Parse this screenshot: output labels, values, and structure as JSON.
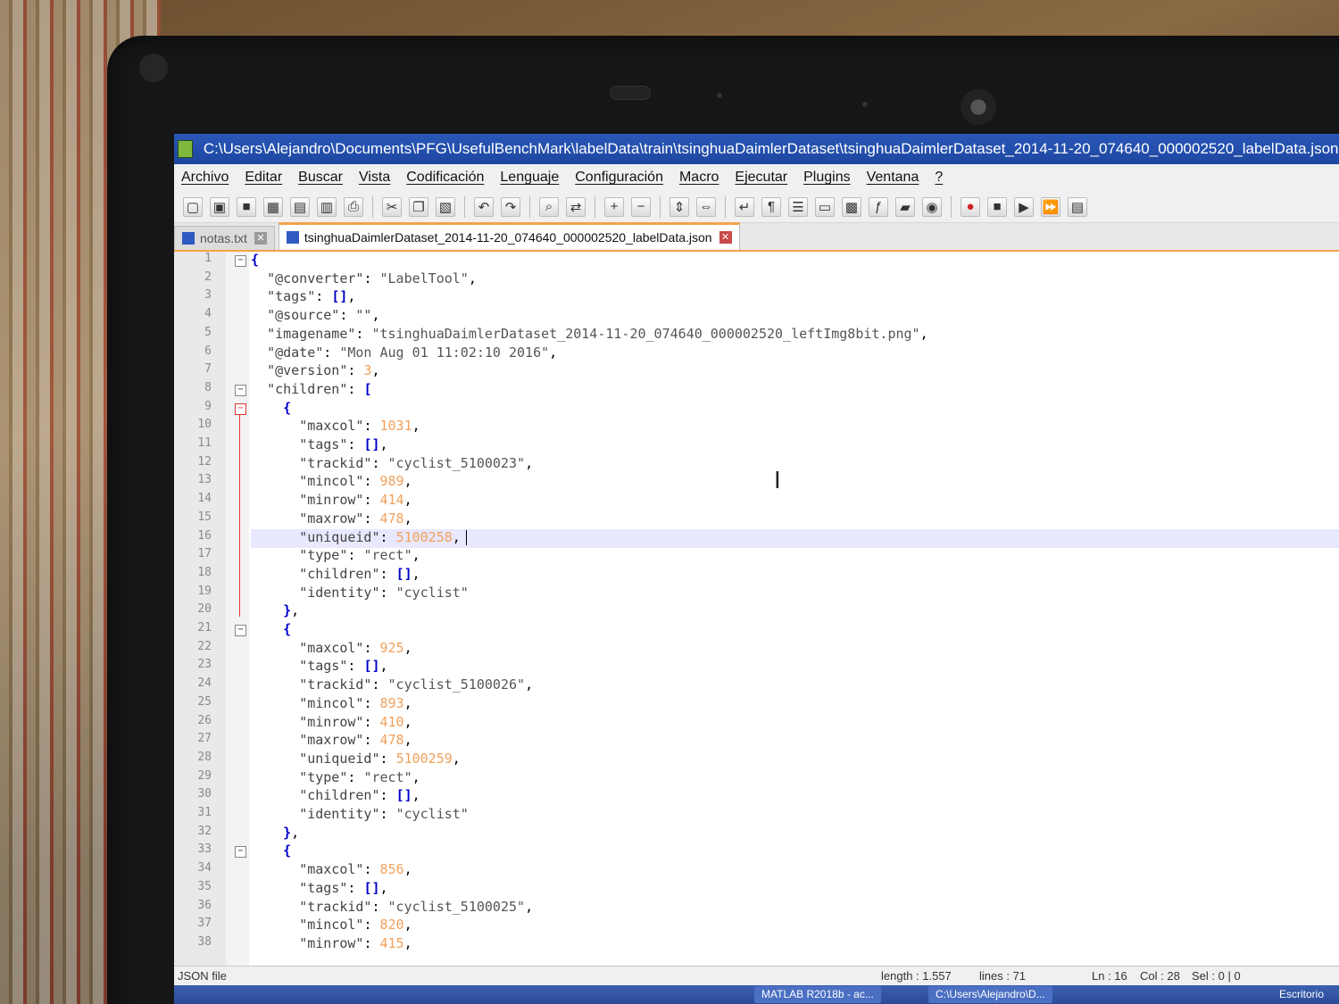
{
  "window": {
    "title": "C:\\Users\\Alejandro\\Documents\\PFG\\UsefulBenchMark\\labelData\\train\\tsinghuaDaimlerDataset\\tsinghuaDaimlerDataset_2014-11-20_074640_000002520_labelData.json - Notepad++"
  },
  "menu": [
    "Archivo",
    "Editar",
    "Buscar",
    "Vista",
    "Codificación",
    "Lenguaje",
    "Configuración",
    "Macro",
    "Ejecutar",
    "Plugins",
    "Ventana",
    "?"
  ],
  "tabs": [
    {
      "label": "notas.txt",
      "active": false
    },
    {
      "label": "tsinghuaDaimlerDataset_2014-11-20_074640_000002520_labelData.json",
      "active": true
    }
  ],
  "editor": {
    "current_line": 16,
    "lines": [
      {
        "n": "1",
        "text": "{",
        "fold": "open"
      },
      {
        "n": "2",
        "text": "  \"@converter\": \"LabelTool\","
      },
      {
        "n": "3",
        "text": "  \"tags\": [],"
      },
      {
        "n": "4",
        "text": "  \"@source\": \"\","
      },
      {
        "n": "5",
        "text": "  \"imagename\": \"tsinghuaDaimlerDataset_2014-11-20_074640_000002520_leftImg8bit.png\","
      },
      {
        "n": "6",
        "text": "  \"@date\": \"Mon Aug 01 11:02:10 2016\","
      },
      {
        "n": "7",
        "text": "  \"@version\": 3,"
      },
      {
        "n": "8",
        "text": "  \"children\": [",
        "fold": "open"
      },
      {
        "n": "9",
        "text": "    {",
        "fold": "open-red"
      },
      {
        "n": "10",
        "text": "      \"maxcol\": 1031,"
      },
      {
        "n": "11",
        "text": "      \"tags\": [],"
      },
      {
        "n": "12",
        "text": "      \"trackid\": \"cyclist_5100023\","
      },
      {
        "n": "13",
        "text": "      \"mincol\": 989,"
      },
      {
        "n": "14",
        "text": "      \"minrow\": 414,"
      },
      {
        "n": "15",
        "text": "      \"maxrow\": 478,"
      },
      {
        "n": "16",
        "text": "      \"uniqueid\": 5100258,"
      },
      {
        "n": "17",
        "text": "      \"type\": \"rect\","
      },
      {
        "n": "18",
        "text": "      \"children\": [],"
      },
      {
        "n": "19",
        "text": "      \"identity\": \"cyclist\""
      },
      {
        "n": "20",
        "text": "    },"
      },
      {
        "n": "21",
        "text": "    {",
        "fold": "open"
      },
      {
        "n": "22",
        "text": "      \"maxcol\": 925,"
      },
      {
        "n": "23",
        "text": "      \"tags\": [],"
      },
      {
        "n": "24",
        "text": "      \"trackid\": \"cyclist_5100026\","
      },
      {
        "n": "25",
        "text": "      \"mincol\": 893,"
      },
      {
        "n": "26",
        "text": "      \"minrow\": 410,"
      },
      {
        "n": "27",
        "text": "      \"maxrow\": 478,"
      },
      {
        "n": "28",
        "text": "      \"uniqueid\": 5100259,"
      },
      {
        "n": "29",
        "text": "      \"type\": \"rect\","
      },
      {
        "n": "30",
        "text": "      \"children\": [],"
      },
      {
        "n": "31",
        "text": "      \"identity\": \"cyclist\""
      },
      {
        "n": "32",
        "text": "    },"
      },
      {
        "n": "33",
        "text": "    {",
        "fold": "open"
      },
      {
        "n": "34",
        "text": "      \"maxcol\": 856,"
      },
      {
        "n": "35",
        "text": "      \"tags\": [],"
      },
      {
        "n": "36",
        "text": "      \"trackid\": \"cyclist_5100025\","
      },
      {
        "n": "37",
        "text": "      \"mincol\": 820,"
      },
      {
        "n": "38",
        "text": "      \"minrow\": 415,"
      }
    ]
  },
  "status": {
    "language": "JSON file",
    "length": "length : 1.557",
    "lines": "lines : 71",
    "ln": "Ln : 16",
    "col": "Col : 28",
    "sel": "Sel : 0 | 0"
  },
  "taskbar": {
    "items": [
      "MATLAB R2018b - ac...",
      "C:\\Users\\Alejandro\\D..."
    ],
    "right": "Escritorio"
  }
}
